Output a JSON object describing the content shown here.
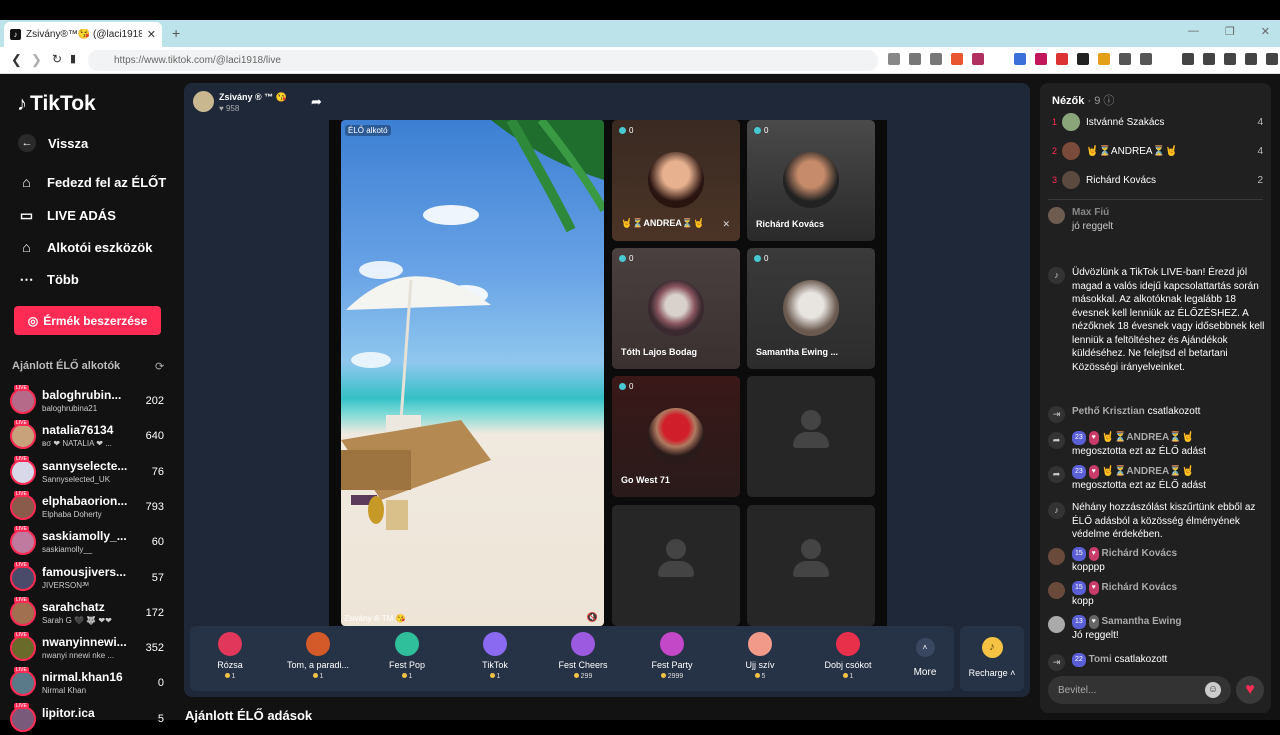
{
  "browser": {
    "tab_title": "Zsivány®™😘 (@laci1918) É...",
    "url": "https://www.tiktok.com/@laci1918/live"
  },
  "sidebar": {
    "logo": "TikTok",
    "nav": [
      {
        "label": "Vissza",
        "icon": "arrow-left-icon"
      },
      {
        "label": "Fedezd fel az ÉLŐT",
        "icon": "explore-icon"
      },
      {
        "label": "LIVE ADÁS",
        "icon": "video-camera-icon"
      },
      {
        "label": "Alkotói eszközök",
        "icon": "creator-tools-icon"
      },
      {
        "label": "Több",
        "icon": "more-dots-icon"
      }
    ],
    "coins_button": "Érmék beszerzése",
    "suggested_title": "Ajánlott ÉLŐ alkotók",
    "creators": [
      {
        "name": "baloghrubin...",
        "sub": "baloghrubina21",
        "count": "202"
      },
      {
        "name": "natalia76134",
        "sub": "вσ ❤ NATALIA ❤ ...",
        "count": "640"
      },
      {
        "name": "sannyselecte...",
        "sub": "Sannyselected_UK",
        "count": "76"
      },
      {
        "name": "elphabaorion...",
        "sub": "Elphaba Doherty",
        "count": "793"
      },
      {
        "name": "saskiamolly_...",
        "sub": "saskiamolly__",
        "count": "60"
      },
      {
        "name": "famousjivers...",
        "sub": "JIVERSONᴶᴹ",
        "count": "57"
      },
      {
        "name": "sarahchatz",
        "sub": "Sarah G 🖤 🐺 ❤❤",
        "count": "172"
      },
      {
        "name": "nwanyinnewi...",
        "sub": "nwanyi nnewi nke ...",
        "count": "352"
      },
      {
        "name": "nirmal.khan16",
        "sub": "Nirmal Khan",
        "count": "0"
      },
      {
        "name": "lipitor.ica",
        "sub": "",
        "count": "5"
      }
    ]
  },
  "host": {
    "name": "Zsivány ® ™ 😘",
    "likes": "♥ 958"
  },
  "stage": {
    "main_label": "ÉLŐ alkotó",
    "main_bottom": "Zsivány ® TM 😘",
    "guests": [
      {
        "name": "🤘⏳ANDREA⏳🤘",
        "viewers": "0",
        "muted": true
      },
      {
        "name": "Richárd Kovács",
        "viewers": "0",
        "muted": false
      },
      {
        "name": "Tóth Lajos Bodag",
        "viewers": "0",
        "muted": false
      },
      {
        "name": "Samantha Ewing ...",
        "viewers": "0",
        "muted": false
      },
      {
        "name": "Go West 71",
        "viewers": "0",
        "muted": false
      }
    ]
  },
  "gifts": [
    {
      "name": "Rózsa",
      "price": "1",
      "color": "#e0375a"
    },
    {
      "name": "Tom, a paradi...",
      "price": "1",
      "color": "#d45a2a"
    },
    {
      "name": "Fest Pop",
      "price": "1",
      "color": "#2fbf9a"
    },
    {
      "name": "TikTok",
      "price": "1",
      "color": "#8a6af0"
    },
    {
      "name": "Fest Cheers",
      "price": "299",
      "color": "#9b5ae0"
    },
    {
      "name": "Fest Party",
      "price": "2999",
      "color": "#c248c8"
    },
    {
      "name": "Ujj szív",
      "price": "5",
      "color": "#f29a8a"
    },
    {
      "name": "Dobj csókot",
      "price": "1",
      "color": "#e8304a"
    }
  ],
  "more_label": "More",
  "recharge_label": "Recharge ˄",
  "bottom_title": "Ajánlott ÉLŐ adások",
  "chat": {
    "viewers_title": "Nézők",
    "viewers_count": "· 9",
    "top_viewers": [
      {
        "rank": "1",
        "name": "Istvánné Szakács",
        "score": "4"
      },
      {
        "rank": "2",
        "name": "🤘⏳ANDREA⏳🤘",
        "score": "4"
      },
      {
        "rank": "3",
        "name": "Richárd Kovács",
        "score": "2"
      }
    ],
    "msg_faded_user": "Max Fiú",
    "msg_faded_text": "jó reggelt",
    "welcome": "Üdvözlünk a TikTok LIVE-ban! Érezd jól magad a valós idejű kapcsolattartás során másokkal. Az alkotóknak legalább 18 évesnek kell lenniük az ÉLŐZÉSHEZ. A nézőknek 18 évesnek vagy idősebbnek kell lenniük a feltöltéshez és Ajándékok küldéséhez. Ne felejtsd el betartani Közösségi irányelveinket.",
    "join1_user": "Pethő Krisztian",
    "join1_text": "csatlakozott",
    "share_badge": "23",
    "share_user": "🤘⏳ANDREA⏳🤘",
    "share_text": "megosztotta ezt az ÉLŐ adást",
    "system_text": "Néhány hozzászólást kiszűrtünk ebből az ÉLŐ adásból a közösség élményének védelme érdekében.",
    "m1_badge": "15",
    "m1_user": "Richárd Kovács",
    "m1_text": "kopppp",
    "m2_badge": "15",
    "m2_user": "Richárd Kovács",
    "m2_text": "kopp",
    "m3_badge": "13",
    "m3_user": "Samantha Ewing",
    "m3_text": "Jó reggelt!",
    "join2_badge": "22",
    "join2_user": "Tomi",
    "join2_text": "csatlakozott",
    "input_placeholder": "Bevitel..."
  }
}
